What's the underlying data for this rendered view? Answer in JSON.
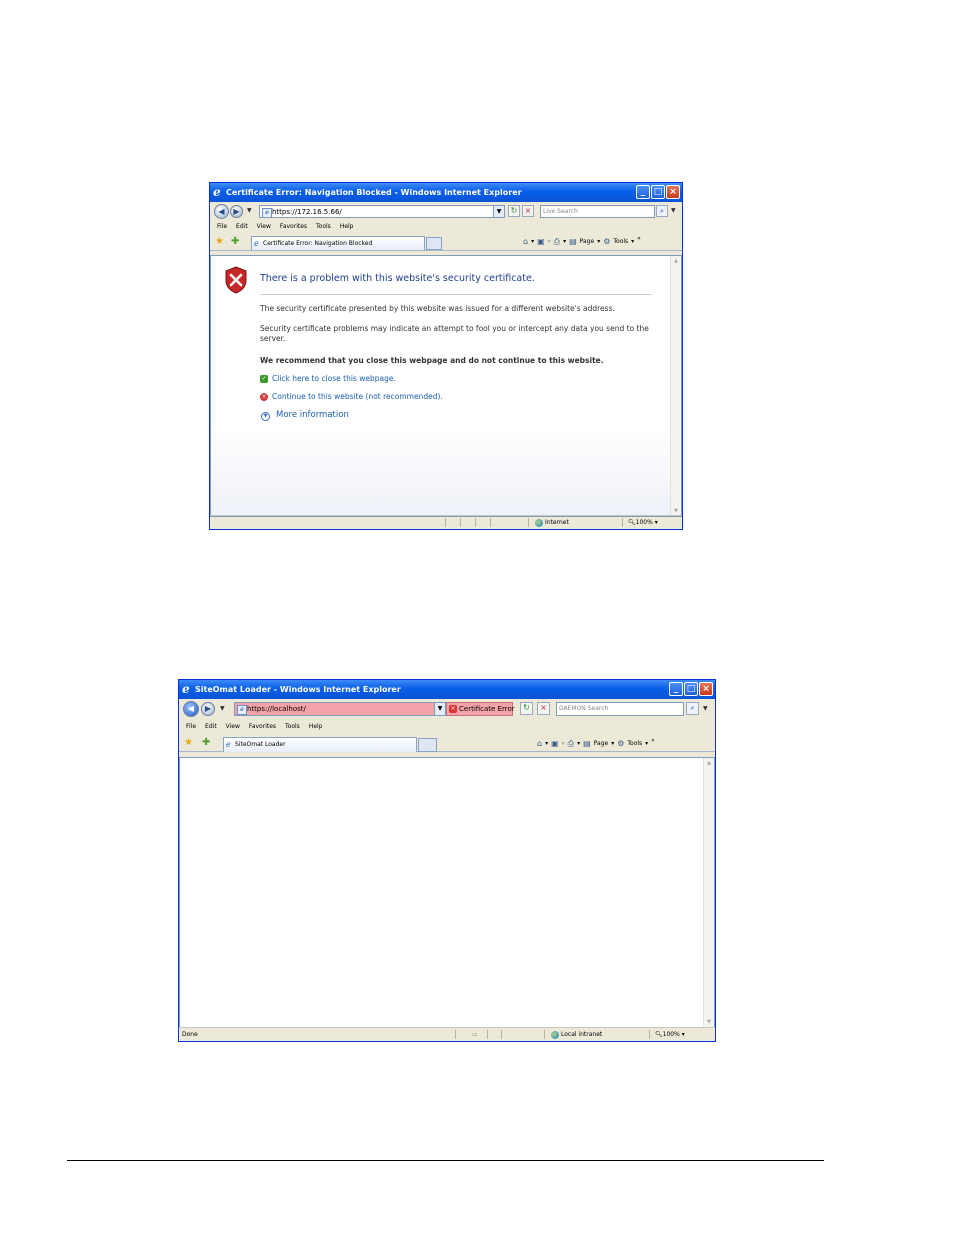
{
  "window1": {
    "title": "Certificate Error: Navigation Blocked - Windows Internet Explorer",
    "url": "https://172.16.5.66/",
    "search_placeholder": "Live Search",
    "menu": [
      "File",
      "Edit",
      "View",
      "Favorites",
      "Tools",
      "Help"
    ],
    "tab_label": "Certificate Error: Navigation Blocked",
    "cmd_page": "Page",
    "cmd_tools": "Tools",
    "heading": "There is a problem with this website's security certificate.",
    "para1": "The security certificate presented by this website was issued for a different website's address.",
    "para2": "Security certificate problems may indicate an attempt to fool you or intercept any data you send to the server.",
    "recommend": "We recommend that you close this webpage and do not continue to this website.",
    "link_close": "Click here to close this webpage.",
    "link_continue": "Continue to this website (not recommended).",
    "more_info": "More information",
    "status_zone": "Internet",
    "zoom": "100%"
  },
  "window2": {
    "title": "SiteOmat Loader - Windows Internet Explorer",
    "url": "https://localhost/",
    "cert_error": "Certificate Error",
    "search_placeholder": "DAEMON Search",
    "menu": [
      "File",
      "Edit",
      "View",
      "Favorites",
      "Tools",
      "Help"
    ],
    "tab_label": "SiteOmat Loader",
    "cmd_page": "Page",
    "cmd_tools": "Tools",
    "status_left": "Done",
    "status_zone": "Local intranet",
    "zoom": "100%"
  },
  "colors": {
    "titlebar": "#0a5ee8",
    "address_error": "#f5a3ab",
    "link": "#1a5fb4",
    "heading": "#1f3f8c"
  }
}
